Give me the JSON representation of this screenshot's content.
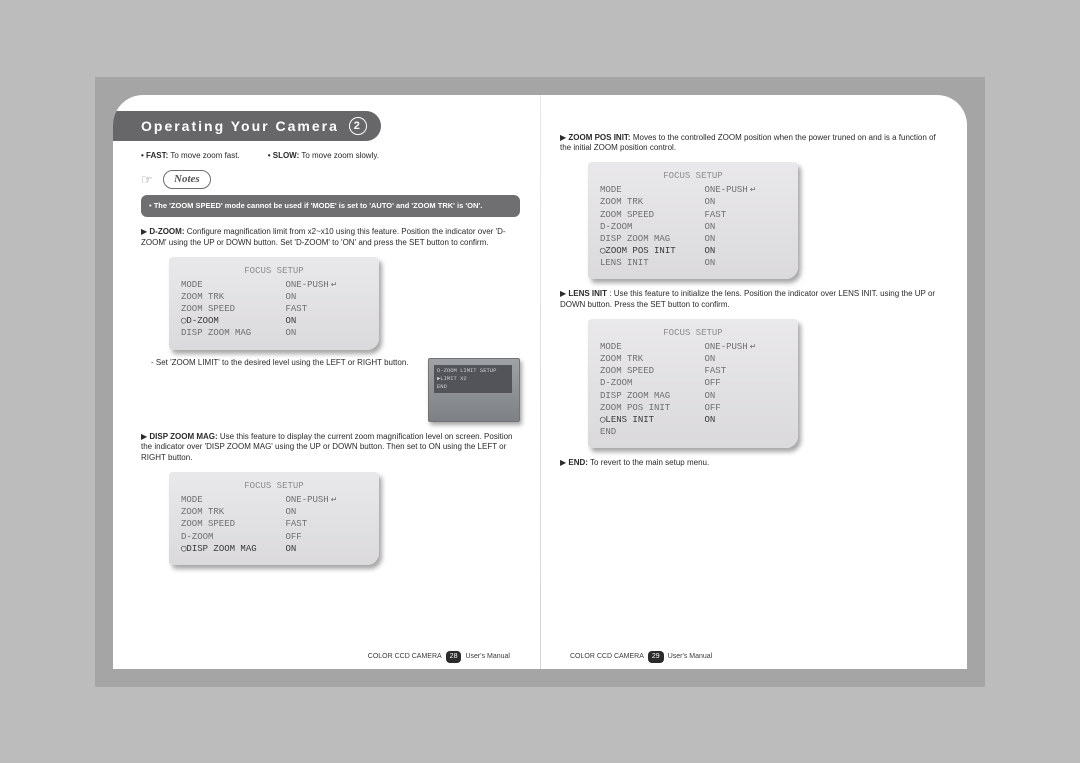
{
  "header": {
    "title": "Operating Your Camera",
    "chapter": "2"
  },
  "left": {
    "fast": {
      "lbl": "FAST:",
      "txt": "To move zoom fast."
    },
    "slow": {
      "lbl": "SLOW:",
      "txt": "To move zoom slowly."
    },
    "notes_label": "Notes",
    "note_text": "The 'ZOOM SPEED' mode cannot be used if 'MODE' is set to 'AUTO' and 'ZOOM TRK' is 'ON'.",
    "dzoom": {
      "lbl": "D-ZOOM:",
      "txt": "Configure magnification limit from x2~x10 using this feature. Position the indicator over 'D-ZOOM' using the UP or DOWN button. Set 'D-ZOOM' to 'ON' and press the SET button to confirm.",
      "sub": "- Set 'ZOOM LIMIT' to the desired level using the LEFT or RIGHT button."
    },
    "osd1": {
      "title": "FOCUS SETUP",
      "rows": [
        {
          "k": "MODE",
          "v": "ONE-PUSH",
          "ret": true
        },
        {
          "k": "ZOOM TRK",
          "v": "ON"
        },
        {
          "k": "ZOOM SPEED",
          "v": "FAST"
        },
        {
          "k": "D-ZOOM",
          "v": "ON",
          "hi": true,
          "mark": true
        },
        {
          "k": "DISP ZOOM MAG",
          "v": "ON"
        }
      ]
    },
    "mini": {
      "l1": "D-ZOOM LIMIT SETUP",
      "l2": "▶LIMIT X2",
      "l3": "END"
    },
    "dispmag": {
      "lbl": "DISP ZOOM MAG:",
      "txt": "Use this feature to display the current zoom magnification level on screen. Position the indicator over 'DISP ZOOM MAG' using the UP or DOWN button. Then set to ON using the LEFT or RIGHT button."
    },
    "osd2": {
      "title": "FOCUS SETUP",
      "rows": [
        {
          "k": "MODE",
          "v": "ONE-PUSH",
          "ret": true
        },
        {
          "k": "ZOOM TRK",
          "v": "ON"
        },
        {
          "k": "ZOOM SPEED",
          "v": "FAST"
        },
        {
          "k": "D-ZOOM",
          "v": "OFF"
        },
        {
          "k": "DISP ZOOM MAG",
          "v": "ON",
          "hi": true,
          "mark": true
        }
      ]
    },
    "foot": {
      "a": "COLOR CCD CAMERA",
      "pg": "28",
      "b": "User's Manual"
    }
  },
  "right": {
    "zpi": {
      "lbl": "ZOOM POS INIT:",
      "txt": "Moves to the controlled ZOOM position when the power truned on and is a function of the initial ZOOM position control."
    },
    "osd3": {
      "title": "FOCUS SETUP",
      "rows": [
        {
          "k": "MODE",
          "v": "ONE-PUSH",
          "ret": true
        },
        {
          "k": "ZOOM TRK",
          "v": "ON"
        },
        {
          "k": "ZOOM SPEED",
          "v": "FAST"
        },
        {
          "k": "D-ZOOM",
          "v": "ON"
        },
        {
          "k": "DISP ZOOM MAG",
          "v": "ON"
        },
        {
          "k": "ZOOM POS INIT",
          "v": "ON",
          "hi": true,
          "mark": true
        },
        {
          "k": "LENS INIT",
          "v": "ON"
        }
      ]
    },
    "lens": {
      "lbl": "LENS INIT",
      "txt": ": Use this feature to initialize the lens. Position the indicator over LENS INIT. using the UP or DOWN button. Press the SET button to confirm."
    },
    "osd4": {
      "title": "FOCUS SETUP",
      "rows": [
        {
          "k": "MODE",
          "v": "ONE-PUSH",
          "ret": true
        },
        {
          "k": "ZOOM TRK",
          "v": "ON"
        },
        {
          "k": "ZOOM SPEED",
          "v": "FAST"
        },
        {
          "k": "D-ZOOM",
          "v": "OFF"
        },
        {
          "k": "DISP ZOOM MAG",
          "v": "ON"
        },
        {
          "k": "ZOOM POS INIT",
          "v": "OFF"
        },
        {
          "k": "LENS INIT",
          "v": "ON",
          "hi": true,
          "mark": true
        },
        {
          "k": "END",
          "v": ""
        }
      ]
    },
    "end": {
      "lbl": "END:",
      "txt": "To revert to the main setup menu."
    },
    "foot": {
      "a": "COLOR CCD CAMERA",
      "pg": "29",
      "b": "User's Manual"
    }
  }
}
